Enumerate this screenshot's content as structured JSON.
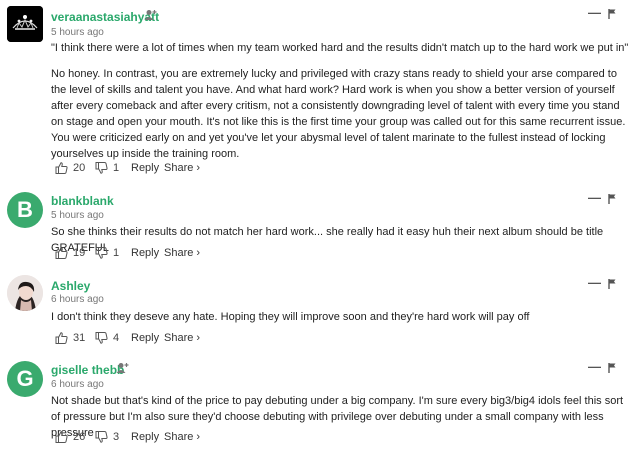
{
  "comments": [
    {
      "username": "veraanastasiahyatt",
      "time": "5 hours ago",
      "avatar_letter": "",
      "paragraphs": [
        "\"I think there were a lot of times when my team worked hard and the results didn't match up to the hard work we put in\"",
        "No honey. In contrast, you are extremely lucky and privileged with crazy stans ready to shield your arse compared to the level of skills and talent you have. And what hard work? Hard work is when you show a better version of yourself after every comeback and after every critism, not a consistently downgrading level of talent with every time you stand on stage and open your mouth. It's not like this is the first time your group was called out for this same recurrent issue. You were criticized early on and yet you've let your abysmal level of talent marinate to the fullest instead of locking yourselves up inside the training room."
      ],
      "likes": "20",
      "dislikes": "1",
      "reply": "Reply",
      "share": "Share ›"
    },
    {
      "username": "blankblank",
      "time": "5 hours ago",
      "avatar_letter": "B",
      "paragraphs": [
        "So she thinks their results do not match her hard work... she really had it easy huh their next album should be title GRATEFUL"
      ],
      "likes": "19",
      "dislikes": "1",
      "reply": "Reply",
      "share": "Share ›"
    },
    {
      "username": "Ashley",
      "time": "6 hours ago",
      "avatar_letter": "",
      "paragraphs": [
        "I don't think they deseve any hate. Hoping they will improve soon and they're hard work will pay off"
      ],
      "likes": "31",
      "dislikes": "4",
      "reply": "Reply",
      "share": "Share ›"
    },
    {
      "username": "giselle thebb",
      "time": "6 hours ago",
      "avatar_letter": "G",
      "paragraphs": [
        "Not shade but that's kind of the price to pay debuting under a big company. I'm sure every big3/big4 idols feel this sort of pressure but I'm also sure they'd choose debuting with privilege over debuting under a small company with less pressure"
      ],
      "likes": "26",
      "dislikes": "3",
      "reply": "Reply",
      "share": "Share ›"
    }
  ],
  "colors": {
    "username": "#2aa86b",
    "avatar_letter_bg": "#3aaa6e",
    "timestamp": "#777777"
  }
}
